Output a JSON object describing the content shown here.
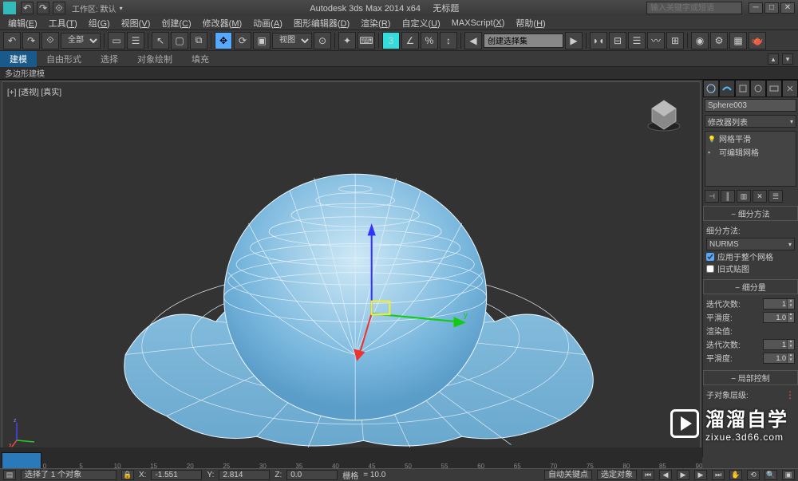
{
  "title": {
    "app": "Autodesk 3ds Max  2014 x64",
    "doc": "无标题"
  },
  "workspace": {
    "label": "工作区: 默认"
  },
  "search": {
    "placeholder": "输入关键字或短语"
  },
  "menu": [
    {
      "l": "编辑",
      "k": "E"
    },
    {
      "l": "工具",
      "k": "T"
    },
    {
      "l": "组",
      "k": "G"
    },
    {
      "l": "视图",
      "k": "V"
    },
    {
      "l": "创建",
      "k": "C"
    },
    {
      "l": "修改器",
      "k": "M"
    },
    {
      "l": "动画",
      "k": "A"
    },
    {
      "l": "图形编辑器",
      "k": "D"
    },
    {
      "l": "渲染",
      "k": "R"
    },
    {
      "l": "自定义",
      "k": "U"
    },
    {
      "l": "MAXScript",
      "k": "X"
    },
    {
      "l": "帮助",
      "k": "H"
    }
  ],
  "toolbar": {
    "select_filter": "全部",
    "view_dd": "视图",
    "search_field": "创建选择集"
  },
  "ribbon": {
    "tabs": [
      "建模",
      "自由形式",
      "选择",
      "对象绘制",
      "填充"
    ],
    "active": 0,
    "sub": "多边形建模"
  },
  "viewport": {
    "label": "[+] [透视] [真实]"
  },
  "cmd": {
    "object": "Sphere003",
    "modlist_dd": "修改器列表",
    "stack": [
      {
        "icon": "bulb",
        "name": "网格平滑"
      },
      {
        "icon": "box",
        "name": "可编辑网格"
      }
    ],
    "rollouts": {
      "r1": {
        "title": "细分方法",
        "method_label": "细分方法:",
        "method": "NURMS",
        "cb1": "应用于整个网格",
        "cb1v": true,
        "cb2": "旧式贴图",
        "cb2v": false
      },
      "r2": {
        "title": "细分量",
        "iter_l": "迭代次数:",
        "iter_v": "1",
        "smooth_l": "平滑度:",
        "smooth_v": "1.0",
        "render_l": "渲染值:",
        "riter_l": "迭代次数:",
        "riter_v": "1",
        "rsmooth_l": "平滑度:",
        "rsmooth_v": "1.0"
      },
      "r3": {
        "title": "局部控制",
        "sub_l": "子对象层级:"
      }
    }
  },
  "status": {
    "selection": "选择了 1 个对象",
    "x": "-1.551",
    "y": "2.814",
    "z": "0.0",
    "grid_l": "栅格",
    "grid_v": "= 10.0",
    "autokey": "自动关键点",
    "selected": "选定对象"
  },
  "timeline": {
    "ticks": [
      0,
      5,
      10,
      15,
      20,
      25,
      30,
      35,
      40,
      45,
      50,
      55,
      60,
      65,
      70,
      75,
      80,
      85,
      90
    ]
  },
  "watermark": {
    "big": "溜溜自学",
    "small": "zixue.3d66.com"
  }
}
